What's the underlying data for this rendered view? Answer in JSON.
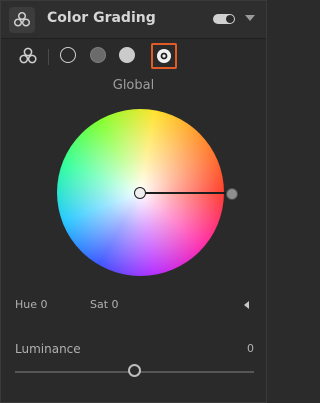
{
  "panel": {
    "title": "Color Grading",
    "enabled": true
  },
  "toolbar": {
    "modes": [
      {
        "name": "3-way",
        "icon": "three-circles-icon"
      },
      {
        "name": "Shadows",
        "icon": "circle-outline-icon"
      },
      {
        "name": "Midtones",
        "icon": "circle-gray-icon"
      },
      {
        "name": "Highlights",
        "icon": "circle-light-icon"
      },
      {
        "name": "Global",
        "icon": "global-circle-icon",
        "selected": true
      }
    ]
  },
  "mode_label": "Global",
  "wheel": {
    "hue": 0,
    "saturation": 0
  },
  "readouts": {
    "hue_label": "Hue 0",
    "sat_label": "Sat 0"
  },
  "luminance": {
    "label": "Luminance",
    "value": "0",
    "level": 0.5
  },
  "colors": {
    "accent": "#e25a25",
    "background": "#2b2b2b",
    "text": "#c8c8c8"
  }
}
